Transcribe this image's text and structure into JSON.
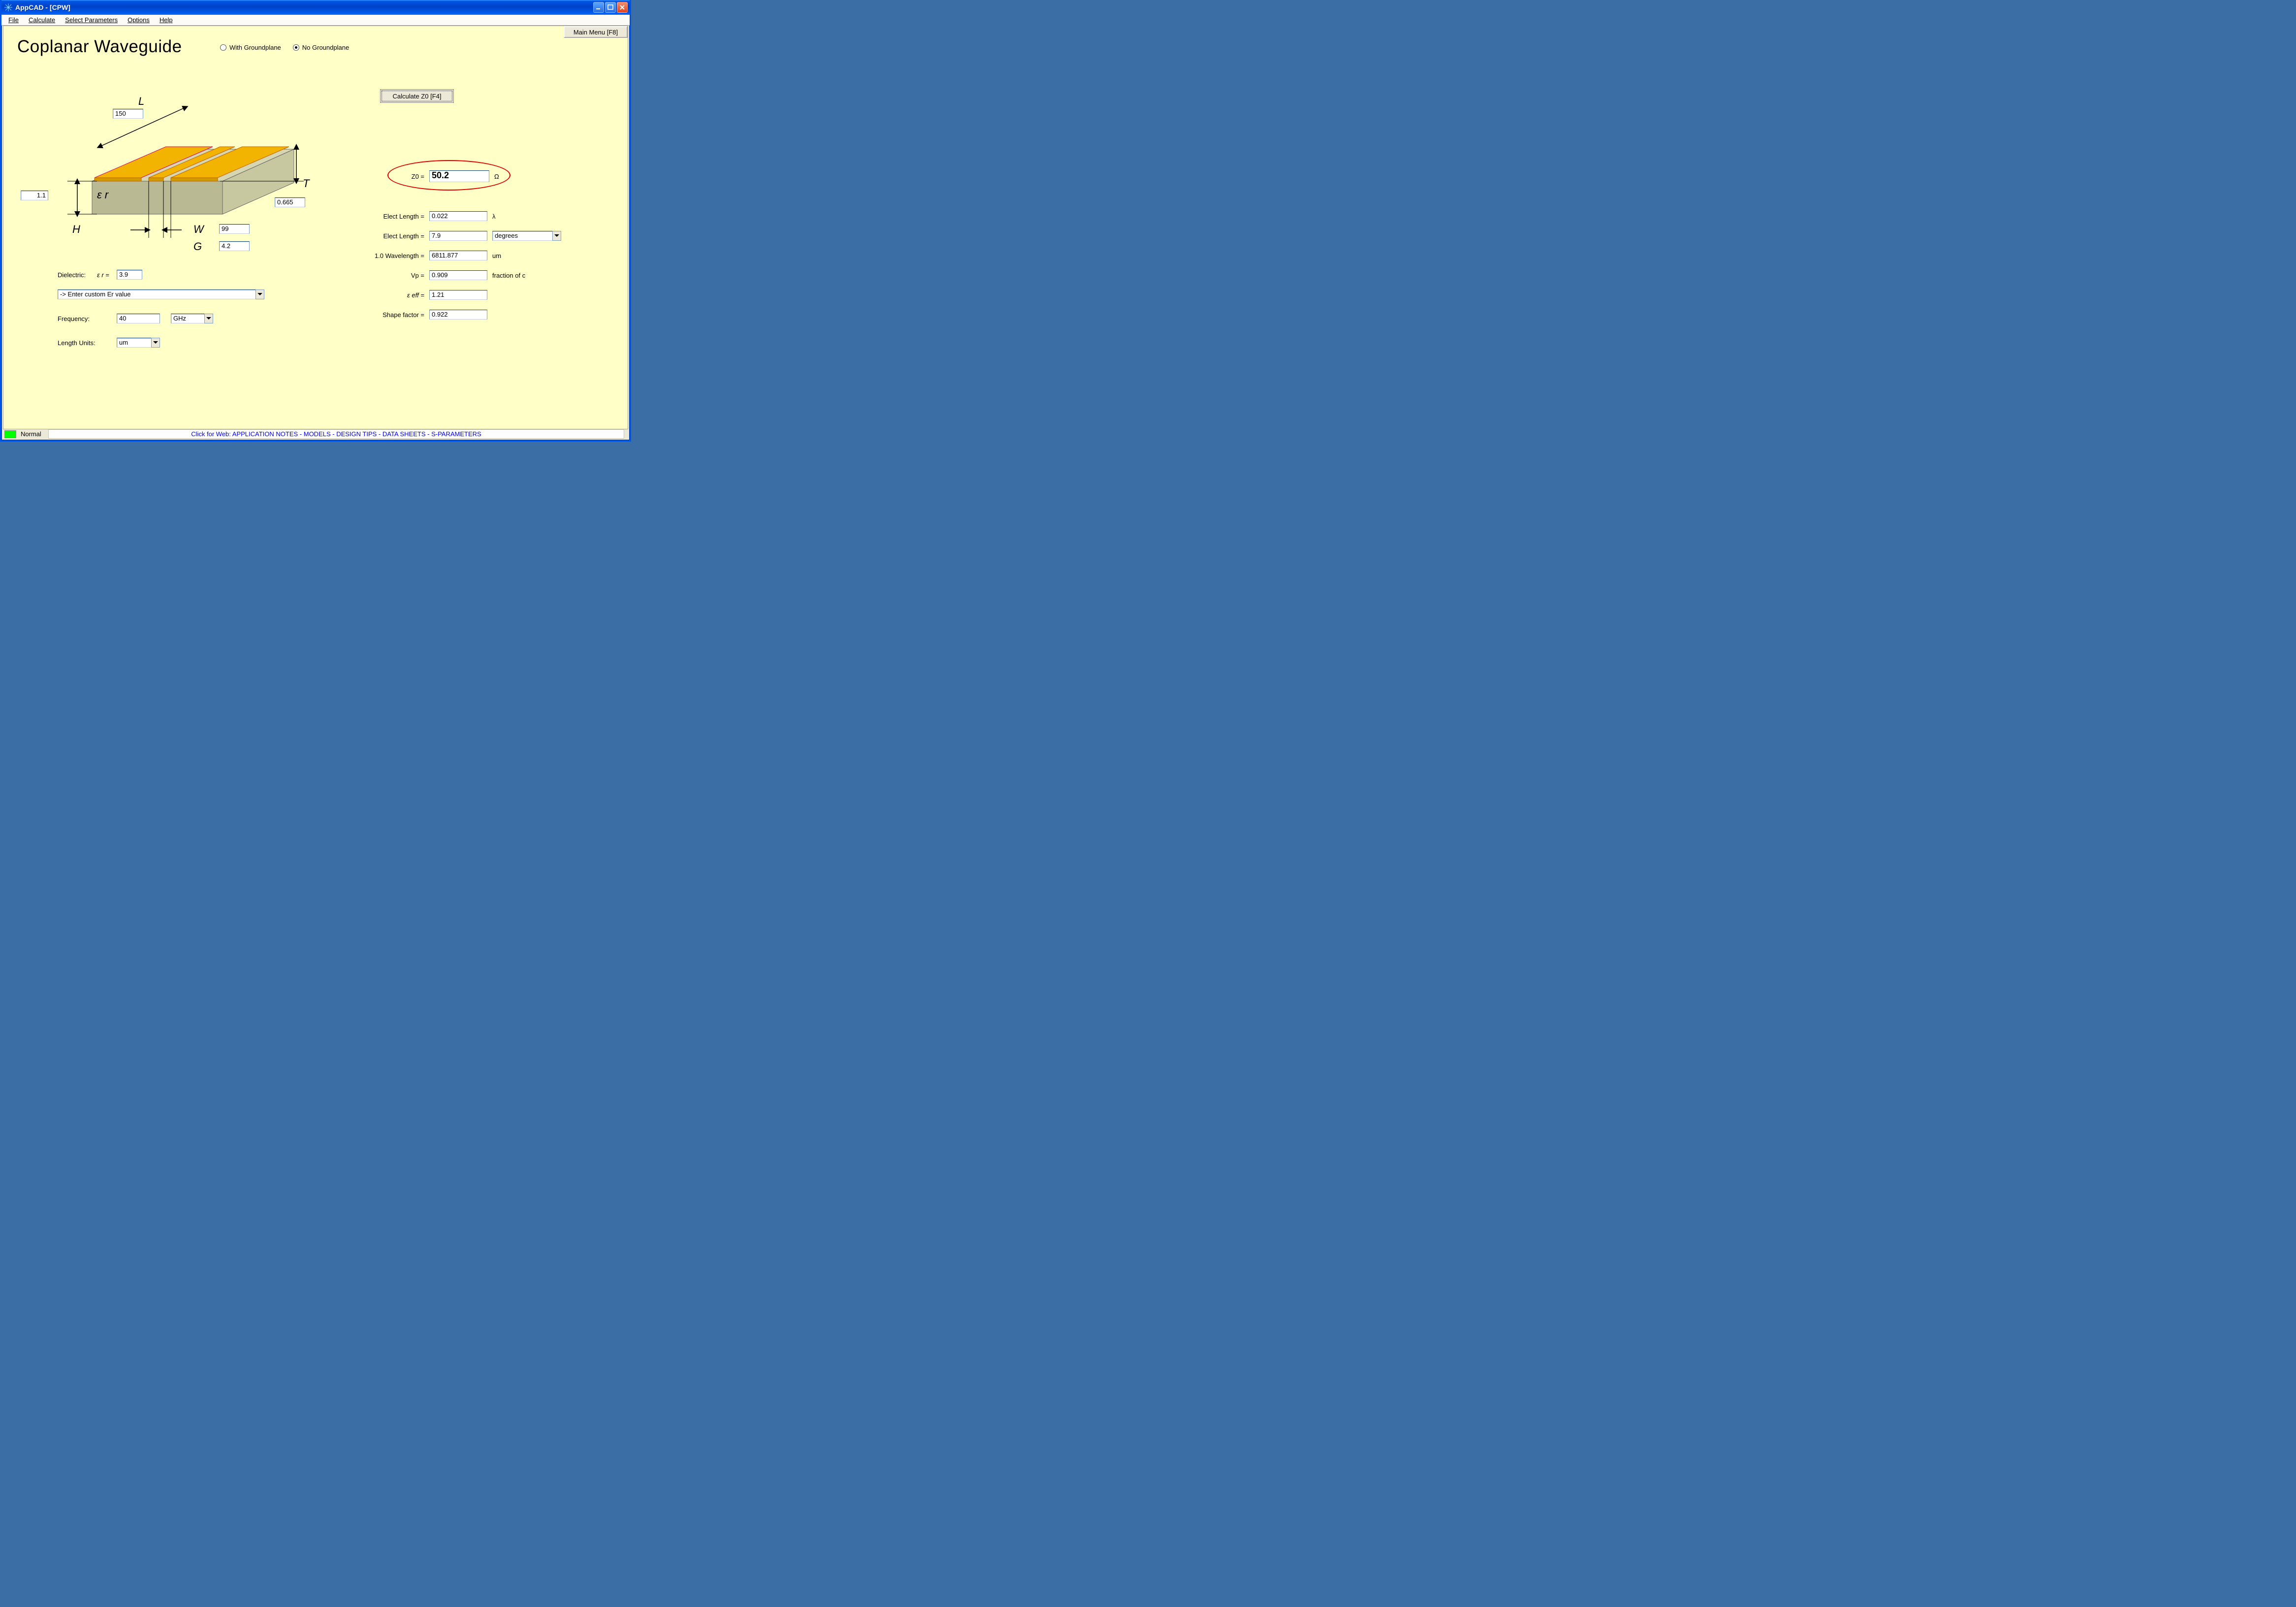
{
  "window": {
    "title": "AppCAD - [CPW]"
  },
  "menus": {
    "file": "File",
    "calculate": "Calculate",
    "select_params": "Select Parameters",
    "options": "Options",
    "help": "Help"
  },
  "buttons": {
    "main_menu": "Main Menu [F8]",
    "calculate_z0": "Calculate Z0  [F4]"
  },
  "heading": "Coplanar Waveguide",
  "radios": {
    "with_gp": "With Groundplane",
    "no_gp": "No Groundplane",
    "selected": "no_gp"
  },
  "diagram": {
    "L_label": "L",
    "L_value": "150",
    "H_label": "H",
    "H_value": "1.1",
    "eps_r_label": "ε r",
    "T_label": "T",
    "T_value": "0.665",
    "W_label": "W",
    "W_value": "99",
    "G_label": "G",
    "G_value": "4.2"
  },
  "params": {
    "dielectric_label": "Dielectric:",
    "eps_r_sym": "ε r  =",
    "eps_r_value": "3.9",
    "er_select_text": "-> Enter custom Er value",
    "frequency_label": "Frequency:",
    "frequency_value": "40",
    "frequency_unit": "GHz",
    "length_units_label": "Length Units:",
    "length_units_value": "um"
  },
  "outputs": {
    "z0_label": "Z0  =",
    "z0_value": "50.2",
    "z0_unit": "Ω",
    "elen_lambda_label": "Elect Length  =",
    "elen_lambda_value": "0.022",
    "elen_lambda_unit": "λ",
    "elen_deg_label": "Elect Length  =",
    "elen_deg_value": "7.9",
    "elen_deg_unit": "degrees",
    "wavelength_label": "1.0 Wavelength  =",
    "wavelength_value": "6811.877",
    "wavelength_unit": "um",
    "vp_label": "Vp  =",
    "vp_value": "0.909",
    "vp_unit": "fraction of c",
    "eeff_label": "ε eff  =",
    "eeff_value": "1.21",
    "shape_label": "Shape factor  =",
    "shape_value": "0.922"
  },
  "status": {
    "mode": "Normal",
    "web_text": "Click for Web: APPLICATION NOTES - MODELS - DESIGN TIPS - DATA SHEETS - S-PARAMETERS"
  }
}
